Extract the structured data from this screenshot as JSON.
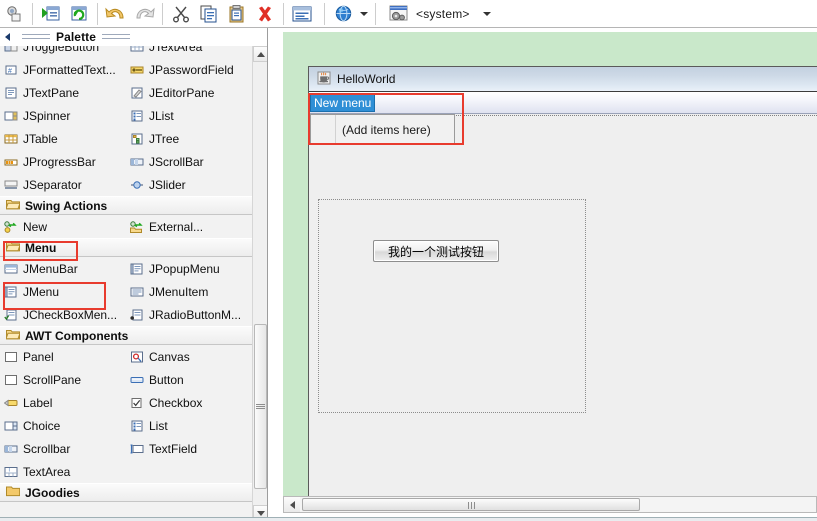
{
  "toolbar": {
    "buttons": [
      {
        "name": "inspect-icon",
        "label": "Inspect"
      },
      {
        "name": "run-icon",
        "label": "Run"
      },
      {
        "name": "refresh-icon",
        "label": "Refresh"
      },
      {
        "name": "undo-icon",
        "label": "Undo"
      },
      {
        "name": "redo-icon",
        "label": "Redo"
      },
      {
        "name": "cut-icon",
        "label": "Cut"
      },
      {
        "name": "copy-icon",
        "label": "Copy"
      },
      {
        "name": "paste-icon",
        "label": "Paste"
      },
      {
        "name": "delete-icon",
        "label": "Delete"
      },
      {
        "name": "properties-icon",
        "label": "Properties"
      },
      {
        "name": "globe-icon",
        "label": "Locale"
      }
    ],
    "lookandfeel": "<system>"
  },
  "palette": {
    "title": "Palette",
    "groups": [
      {
        "name": "swing-components",
        "header": null,
        "items": [
          {
            "label": "JToggleButton",
            "icon": "togglebutton-icon"
          },
          {
            "label": "JTextArea",
            "icon": "textarea-icon"
          },
          {
            "label": "JFormattedText...",
            "icon": "formattedtextfield-icon"
          },
          {
            "label": "JPasswordField",
            "icon": "passwordfield-icon"
          },
          {
            "label": "JTextPane",
            "icon": "textpane-icon"
          },
          {
            "label": "JEditorPane",
            "icon": "editorpane-icon"
          },
          {
            "label": "JSpinner",
            "icon": "spinner-icon"
          },
          {
            "label": "JList",
            "icon": "list-icon"
          },
          {
            "label": "JTable",
            "icon": "table-icon"
          },
          {
            "label": "JTree",
            "icon": "tree-icon"
          },
          {
            "label": "JProgressBar",
            "icon": "progressbar-icon"
          },
          {
            "label": "JScrollBar",
            "icon": "scrollbar-icon"
          },
          {
            "label": "JSeparator",
            "icon": "separator-icon"
          },
          {
            "label": "JSlider",
            "icon": "slider-icon"
          }
        ]
      },
      {
        "name": "swing-actions",
        "header": "Swing Actions",
        "items": [
          {
            "label": "New",
            "icon": "new-action-icon"
          },
          {
            "label": "External...",
            "icon": "external-action-icon"
          }
        ]
      },
      {
        "name": "menu",
        "header": "Menu",
        "items": [
          {
            "label": "JMenuBar",
            "icon": "menubar-icon"
          },
          {
            "label": "JPopupMenu",
            "icon": "popupmenu-icon"
          },
          {
            "label": "JMenu",
            "icon": "menu-icon"
          },
          {
            "label": "JMenuItem",
            "icon": "menuitem-icon"
          },
          {
            "label": "JCheckBoxMen...",
            "icon": "checkboxmenuitem-icon"
          },
          {
            "label": "JRadioButtonM...",
            "icon": "radiobuttonmenuitem-icon"
          }
        ]
      },
      {
        "name": "awt-components",
        "header": "AWT Components",
        "items": [
          {
            "label": "Panel",
            "icon": "panel-icon"
          },
          {
            "label": "Canvas",
            "icon": "canvas-icon"
          },
          {
            "label": "ScrollPane",
            "icon": "scrollpane-icon"
          },
          {
            "label": "Button",
            "icon": "button-icon"
          },
          {
            "label": "Label",
            "icon": "label-icon"
          },
          {
            "label": "Checkbox",
            "icon": "checkbox-icon"
          },
          {
            "label": "Choice",
            "icon": "choice-icon"
          },
          {
            "label": "List",
            "icon": "awtlist-icon"
          },
          {
            "label": "Scrollbar",
            "icon": "awtscrollbar-icon"
          },
          {
            "label": "TextField",
            "icon": "textfield-icon"
          },
          {
            "label": "TextArea",
            "icon": "awttextarea-icon"
          }
        ]
      },
      {
        "name": "jgoodies",
        "header": "JGoodies",
        "items": []
      }
    ]
  },
  "design": {
    "canvas_background": "#c9e8ca",
    "frame": {
      "title": "HelloWorld",
      "title_icon": "java-cup-icon",
      "menubar": {
        "selected_menu": "New menu",
        "dropdown_placeholder": "(Add items here)"
      },
      "button_label": "我的一个测试按钮"
    },
    "hscrollbar": {
      "left_arrow": "scroll-left-arrow"
    }
  },
  "annotations": {
    "highlights": [
      {
        "name": "menu-category-highlight",
        "color": "#e83b2e"
      },
      {
        "name": "jmenu-item-highlight",
        "color": "#e83b2e"
      },
      {
        "name": "new-menu-highlight",
        "color": "#e83b2e"
      }
    ]
  }
}
